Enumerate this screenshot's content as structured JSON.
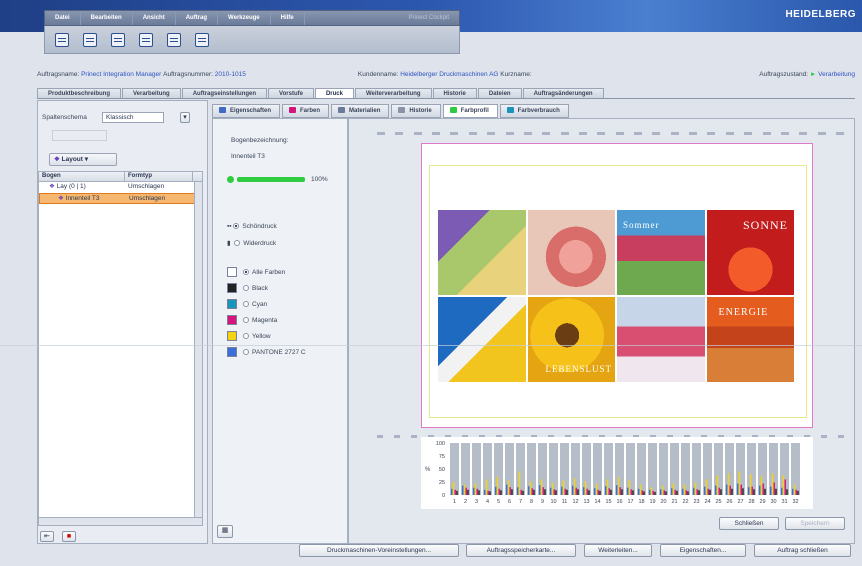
{
  "app": {
    "brand": "HEIDELBERG"
  },
  "menu": {
    "items": [
      "Datei",
      "Bearbeiten",
      "Ansicht",
      "Auftrag",
      "Werkzeuge",
      "Hilfe"
    ],
    "product": "Prinect Cockpit"
  },
  "toolbar": {
    "icons": [
      "open-job-icon",
      "print-icon",
      "job-folder-icon",
      "export-icon",
      "document-icon",
      "save-icon"
    ]
  },
  "info": {
    "job_name_label": "Auftragsname:",
    "job_name": "Prinect Integration Manager",
    "job_number_label": "Auftragsnummer:",
    "job_number": "2010-1015",
    "customer_label": "Kundenname:",
    "customer": "Heidelberger Druckmaschinen AG",
    "short_label": "Kurzname:",
    "status_label": "Auftragszustand:",
    "status": "Verarbeitung",
    "status_color": "#2ecc40"
  },
  "main_tabs": [
    "Produktbeschreibung",
    "Verarbeitung",
    "Auftragseinstellungen",
    "Vorstufe",
    "Druck",
    "Weiterverarbeitung",
    "Historie",
    "Dateien",
    "Auftragsänderungen"
  ],
  "main_tab_active": "Druck",
  "left": {
    "schema_label": "Spaltenschema",
    "schema_value": "Klassisch",
    "layout_button": "Layout",
    "columns": [
      "Bogen",
      "Formtyp"
    ],
    "rows": [
      {
        "name": "Lay",
        "count": "(0 | 1)",
        "type": "Umschlagen"
      },
      {
        "name": "Innenteil T3",
        "type": "Umschlagen"
      }
    ]
  },
  "sub_tabs": [
    "Eigenschaften",
    "Farben",
    "Materialien",
    "Historie",
    "Farbprofil",
    "Farbverbrauch"
  ],
  "sub_tab_active": "Farbprofil",
  "mid": {
    "sheet_label": "Bogenbezeichnung:",
    "sheet_value": "Innenteil T3",
    "progress": "100%",
    "progress_value": 100,
    "sides": [
      "Schöndruck",
      "Widerdruck"
    ],
    "colors": [
      {
        "name": "Alle Farben",
        "hex": "#ffffff",
        "checked": true
      },
      {
        "name": "Black",
        "hex": "#222222"
      },
      {
        "name": "Cyan",
        "hex": "#1a94b8"
      },
      {
        "name": "Magenta",
        "hex": "#d6157c"
      },
      {
        "name": "Yellow",
        "hex": "#f6d40f"
      },
      {
        "name": "PANTONE 2727 C",
        "hex": "#3a6fd8"
      }
    ]
  },
  "sheet_text": {
    "t1": "Sommer",
    "t2": "SONNE",
    "t3": "ENERGIE",
    "t4": "LEBENSLUST"
  },
  "chart_data": {
    "type": "bar",
    "yticks": [
      100,
      75,
      50,
      25,
      0
    ],
    "ylabel": "%",
    "ylim": [
      0,
      100
    ],
    "categories": [
      "1",
      "2",
      "3",
      "4",
      "5",
      "6",
      "7",
      "8",
      "9",
      "10",
      "11",
      "12",
      "13",
      "14",
      "15",
      "16",
      "17",
      "18",
      "19",
      "20",
      "21",
      "22",
      "23",
      "24",
      "25",
      "26",
      "27",
      "28",
      "29",
      "30",
      "31",
      "32"
    ],
    "series": [
      {
        "color": "#3a6fd8",
        "values": [
          12,
          18,
          14,
          10,
          16,
          20,
          15,
          17,
          19,
          14,
          16,
          18,
          15,
          13,
          17,
          19,
          14,
          12,
          10,
          11,
          13,
          12,
          14,
          16,
          18,
          20,
          22,
          15,
          18,
          16,
          14,
          12
        ]
      },
      {
        "color": "#f6d40f",
        "values": [
          25,
          20,
          22,
          30,
          35,
          28,
          45,
          26,
          30,
          24,
          28,
          32,
          26,
          22,
          30,
          34,
          28,
          20,
          15,
          18,
          22,
          20,
          24,
          30,
          38,
          42,
          45,
          40,
          36,
          42,
          38,
          20
        ]
      },
      {
        "color": "#d6157c",
        "values": [
          10,
          14,
          12,
          8,
          12,
          15,
          10,
          13,
          15,
          11,
          12,
          14,
          12,
          10,
          13,
          15,
          11,
          9,
          8,
          9,
          10,
          9,
          11,
          12,
          14,
          18,
          20,
          16,
          22,
          24,
          30,
          10
        ]
      },
      {
        "color": "#222222",
        "values": [
          8,
          10,
          9,
          7,
          9,
          11,
          8,
          10,
          11,
          9,
          10,
          11,
          9,
          8,
          10,
          11,
          9,
          7,
          6,
          7,
          8,
          7,
          9,
          10,
          11,
          12,
          13,
          11,
          12,
          12,
          11,
          8
        ]
      }
    ]
  },
  "buttons": {
    "close_small": "Schließen",
    "disabled_small": "Speichern",
    "press_settings": "Druckmaschinen-Voreinstellungen...",
    "job_card": "Auftragsspeicherkarte...",
    "forward": "Weiterleiten...",
    "properties": "Eigenschaften...",
    "close_job": "Auftrag schließen"
  }
}
